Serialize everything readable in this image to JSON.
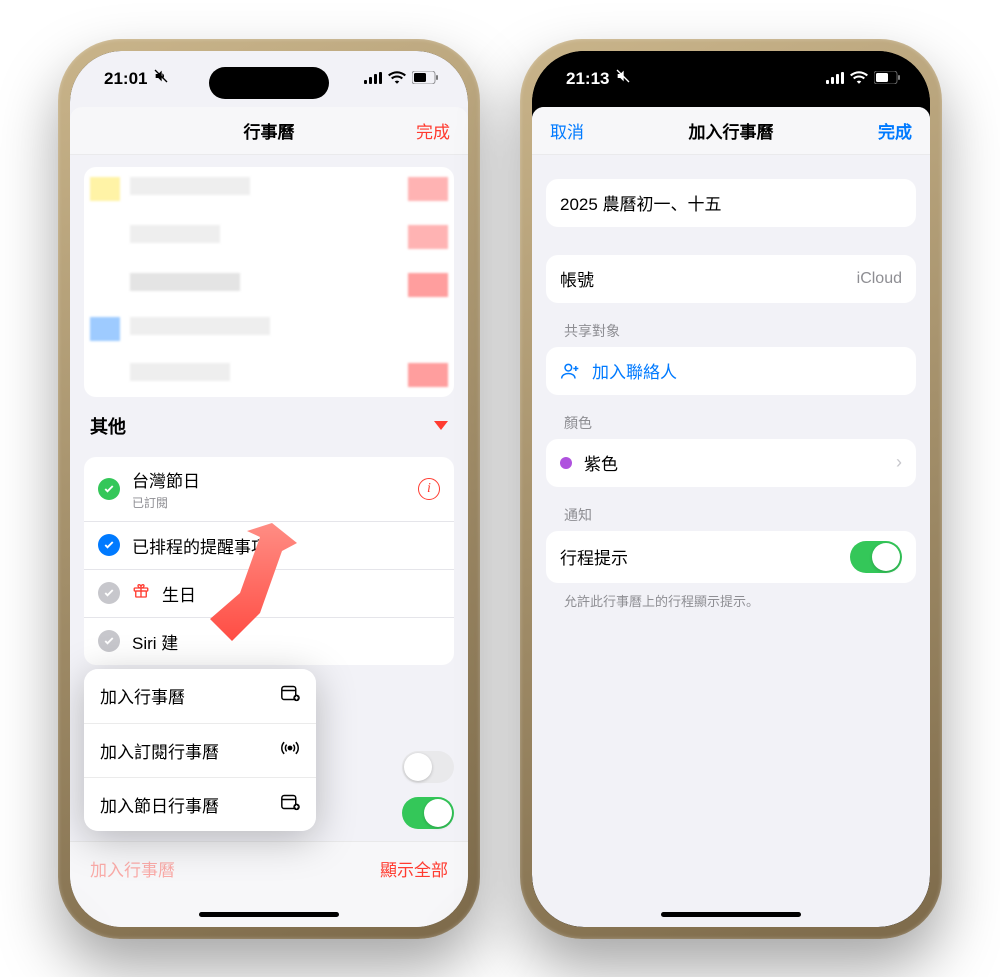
{
  "left": {
    "status": {
      "time": "21:01"
    },
    "nav": {
      "title": "行事曆",
      "done": "完成"
    },
    "other": {
      "header": "其他",
      "items": [
        {
          "title": "台灣節日",
          "sub": "已訂閱",
          "checkColor": "ck-green",
          "info": true
        },
        {
          "title": "已排程的提醒事項",
          "checkColor": "ck-blue"
        },
        {
          "title": "生日",
          "checkColor": "ck-gray",
          "gift": true
        },
        {
          "title": "Siri 建",
          "checkColor": "ck-gray"
        }
      ]
    },
    "popup": {
      "items": [
        {
          "label": "加入行事曆",
          "icon": "calendar-plus-icon"
        },
        {
          "label": "加入訂閱行事曆",
          "icon": "broadcast-icon"
        },
        {
          "label": "加入節日行事曆",
          "icon": "calendar-plus-icon"
        }
      ]
    },
    "bottom": {
      "add": "加入行事曆",
      "showAll": "顯示全部"
    }
  },
  "right": {
    "status": {
      "time": "21:13"
    },
    "nav": {
      "cancel": "取消",
      "title": "加入行事曆",
      "done": "完成"
    },
    "name": {
      "value": "2025 農曆初一、十五"
    },
    "account": {
      "label": "帳號",
      "value": "iCloud"
    },
    "share": {
      "header": "共享對象",
      "action": "加入聯絡人"
    },
    "color": {
      "header": "顏色",
      "label": "紫色",
      "hex": "#af52de"
    },
    "notify": {
      "header": "通知",
      "label": "行程提示",
      "on": true,
      "hint": "允許此行事曆上的行程顯示提示。"
    }
  }
}
